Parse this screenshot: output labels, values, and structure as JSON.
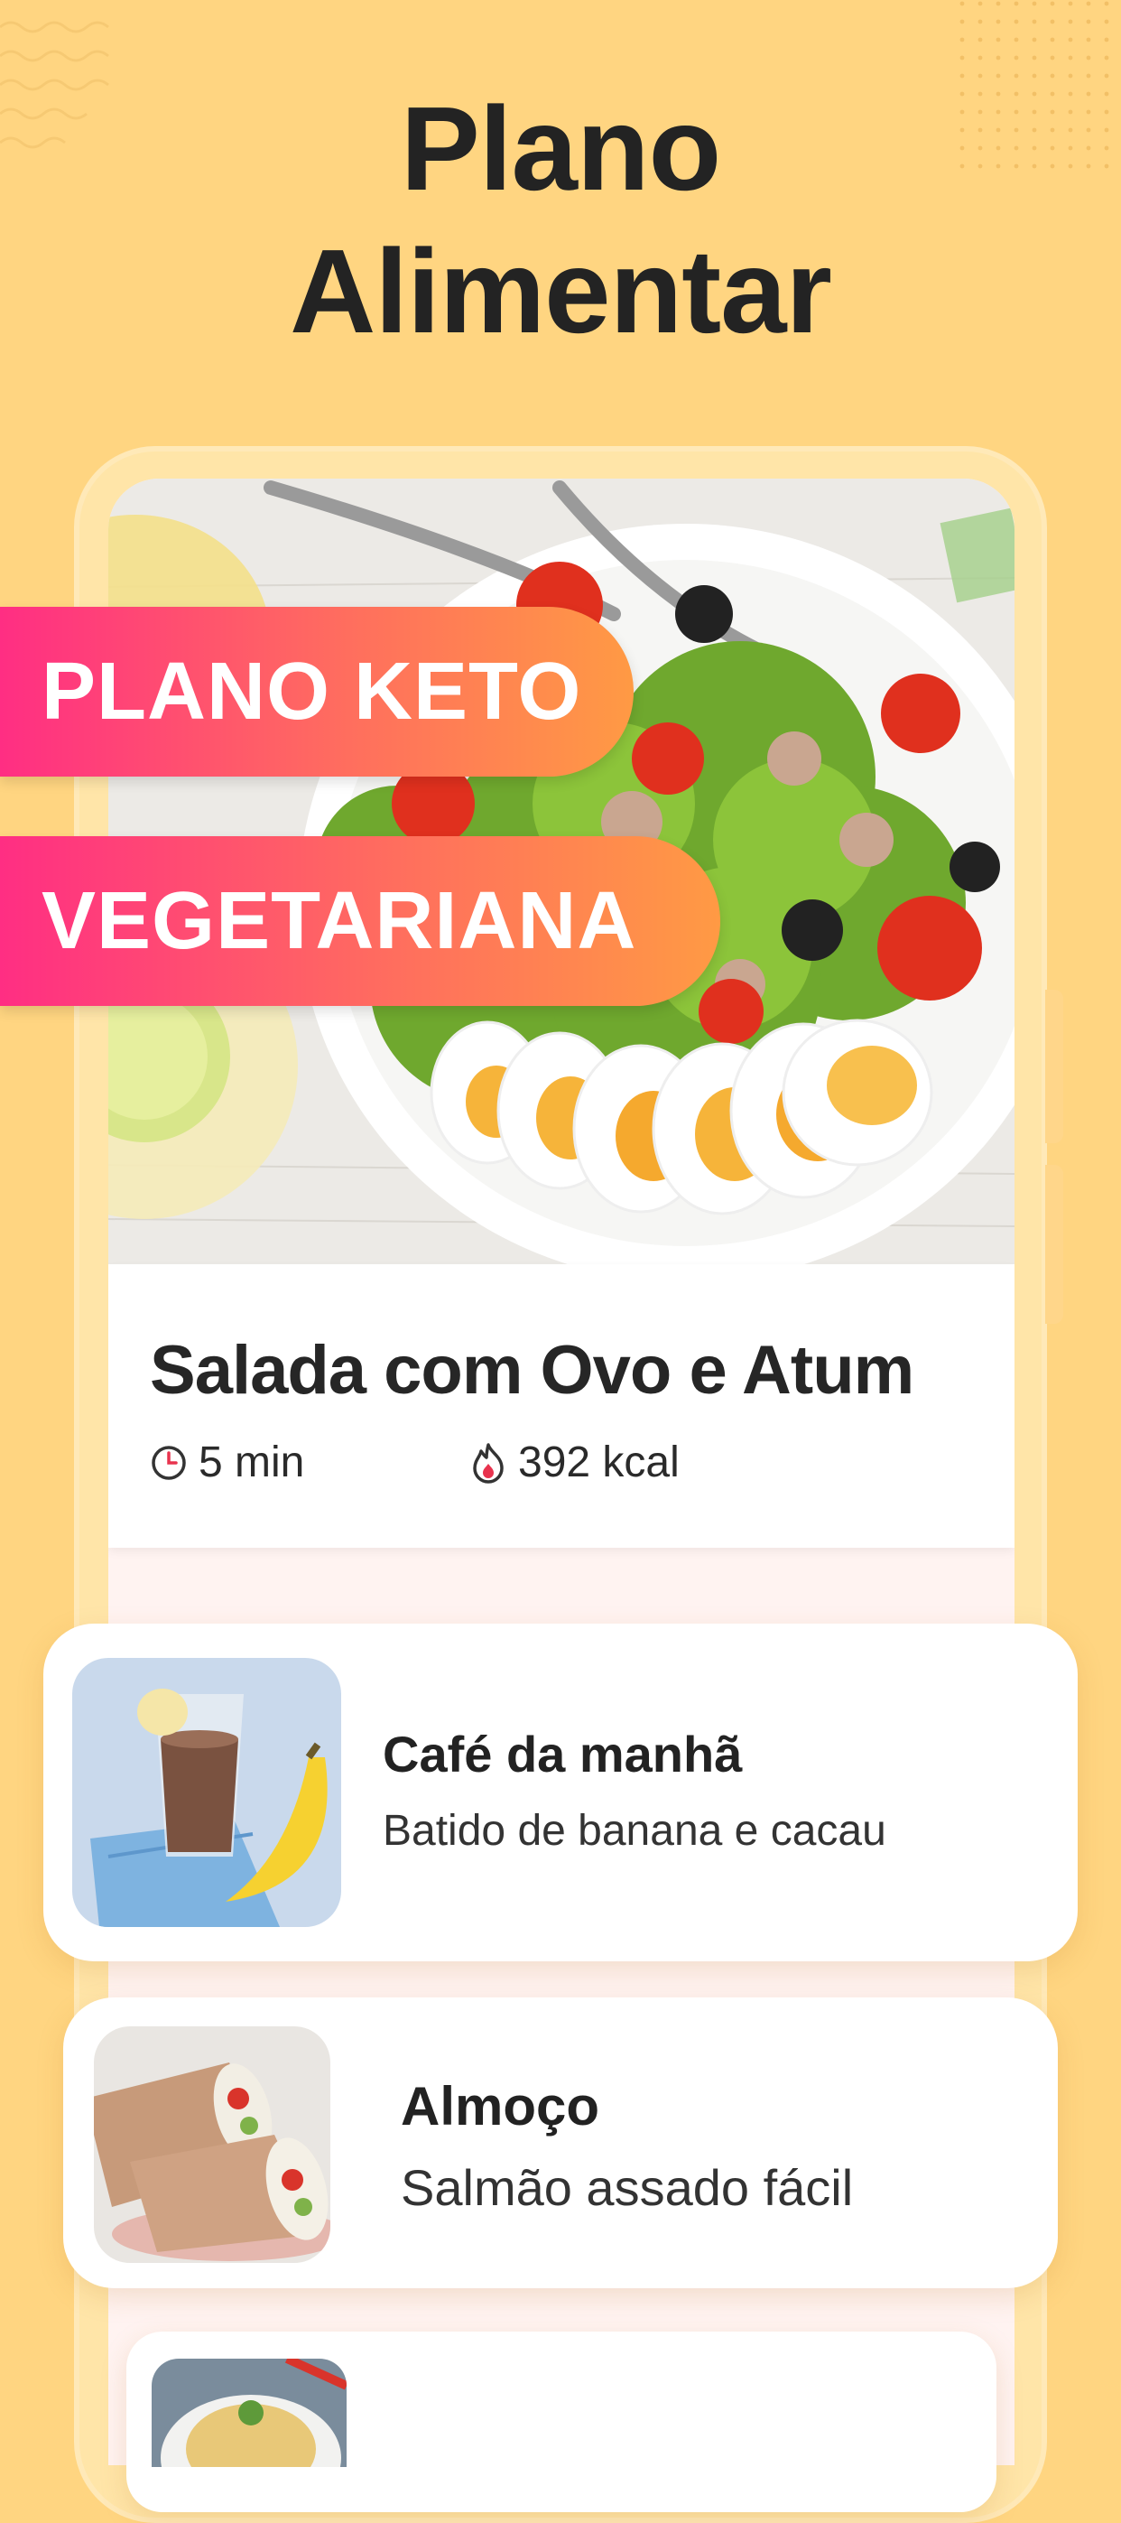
{
  "header": {
    "title_line1": "Plano",
    "title_line2": "Alimentar"
  },
  "badges": {
    "keto": "PLANO KETO",
    "vegetarian": "VEGETARIANA"
  },
  "recipe": {
    "title": "Salada com Ovo e Atum",
    "time": "5 min",
    "calories": "392 kcal"
  },
  "meals": [
    {
      "name": "Café da manhã",
      "desc": "Batido de banana e cacau"
    },
    {
      "name": "Almoço",
      "desc": "Salmão assado fácil"
    }
  ],
  "colors": {
    "background": "#FFD581",
    "badge_start": "#FF2E83",
    "badge_end": "#FF9A44"
  }
}
